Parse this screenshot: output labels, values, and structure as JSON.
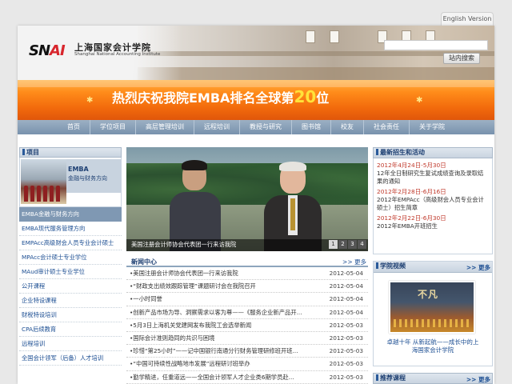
{
  "header": {
    "language_link": "English Version",
    "logo_mark": "SNAI",
    "logo_cn": "上海国家会计学院",
    "logo_en": "Shanghai National Accounting Institute",
    "search_button": "站内搜索",
    "search_placeholder": ""
  },
  "banner": {
    "text_before": "热烈庆祝我院EMBA排名全球第",
    "number": "20",
    "text_after": "位"
  },
  "nav": [
    "首页",
    "学位项目",
    "高层管理培训",
    "远程培训",
    "教授与研究",
    "图书馆",
    "校友",
    "社会责任",
    "关于学院"
  ],
  "left": {
    "box_title": "项目",
    "featured_title": "EMBA",
    "featured_sub": "金融与财务方向",
    "menu": [
      "EMBA金融与财务方向",
      "EMBA现代服务管理方向",
      "EMPAcc高级财会人员专业会计硕士",
      "MPAcc会计硕士专业学位",
      "MAud审计硕士专业学位",
      "公开课程",
      "企业特设课程",
      "财税特设培训",
      "CPA后续教育",
      "远程培训",
      "全国会计领军（后备）人才培训"
    ],
    "active_index": 0
  },
  "slider": {
    "caption": "美国注册会计师协会代表团一行来访我院",
    "pages": [
      "1",
      "2",
      "3",
      "4"
    ],
    "current_page": 1
  },
  "news": {
    "title": "新闻中心",
    "more": ">> 更多",
    "rows": [
      {
        "title": "•美国注册会计师协会代表团一行来访我院",
        "date": "2012-05-04"
      },
      {
        "title": "•“财政支出绩效跟踪管理”课题研讨会在我院召开",
        "date": "2012-05-04"
      },
      {
        "title": "•一小时同誉",
        "date": "2012-05-04"
      },
      {
        "title": "•创新产品市场为导、洞察需求以客为尊——《服务企业新产品开...",
        "date": "2012-05-04"
      },
      {
        "title": "•5月3日上海机关党建网发布我院工会选举新闻",
        "date": "2012-05-03"
      },
      {
        "title": "•国际会计准则趋同的共识与困境",
        "date": "2012-05-03"
      },
      {
        "title": "•珍惜“第25小时”——记中国银行南通分行财务管理研修班开班...",
        "date": "2012-05-03"
      },
      {
        "title": "•“中国可持续性战略地市发展”远程研讨班举办",
        "date": "2012-05-03"
      },
      {
        "title": "•勤学精进，任重道远——全国会计领军人才企业类6期学员赴...",
        "date": "2012-05-03"
      }
    ]
  },
  "admissions": {
    "title": "最新招生和活动",
    "items": [
      {
        "date": "2012年4月24日-5月30日",
        "text": "12年全日制研究生复试成绩查询及录取结果的通知"
      },
      {
        "date": "2012年2月28日-6月16日",
        "text": "2012年EMPAcc（高级财会人员专业会计硕士）招生简章"
      },
      {
        "date": "2012年2月22日-6月30日",
        "text": "2012年EMBA开班招生"
      }
    ]
  },
  "video": {
    "title": "学院视频",
    "more": ">> 更多",
    "thumb_text": "不凡",
    "caption_line1": "卓越十年 从新起航——成长中的上",
    "caption_line2": "海国家会计学院"
  },
  "courses": {
    "title": "推荐课程",
    "more": ">> 更多"
  }
}
